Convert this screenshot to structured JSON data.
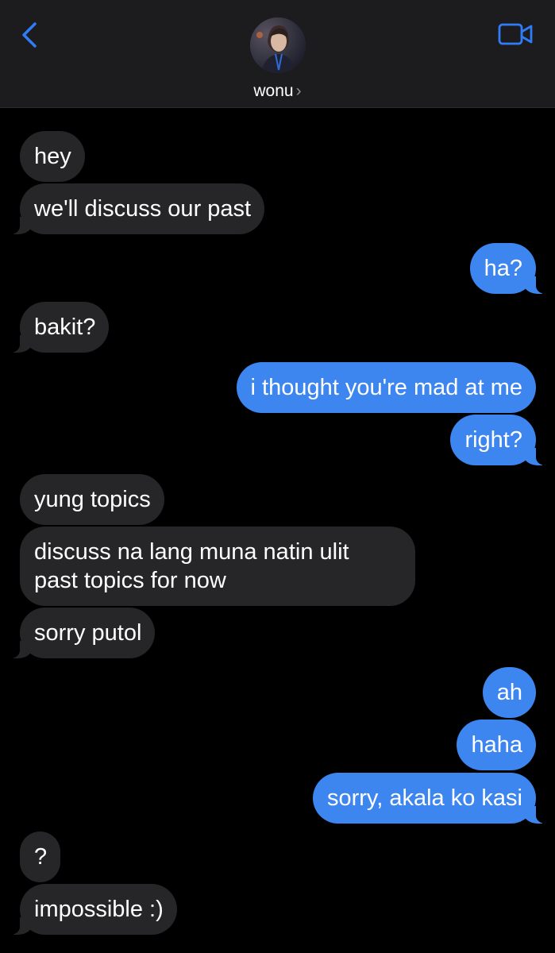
{
  "header": {
    "back_icon": "chevron-left-icon",
    "video_icon": "video-camera-icon",
    "contact_name": "wonu",
    "contact_chevron": "›",
    "accent_color": "#2f7cf6"
  },
  "messages": [
    {
      "from": "them",
      "text": "hey"
    },
    {
      "from": "them",
      "text": "we'll discuss our past"
    },
    {
      "from": "me",
      "text": "ha?"
    },
    {
      "from": "them",
      "text": "bakit?"
    },
    {
      "from": "me",
      "text": "i thought you're mad at me"
    },
    {
      "from": "me",
      "text": "right?"
    },
    {
      "from": "them",
      "text": "yung topics"
    },
    {
      "from": "them",
      "text": "discuss na lang muna natin ulit past topics for now",
      "line1": "discuss na lang muna natin ulit",
      "line2": "past topics for now"
    },
    {
      "from": "them",
      "text": "sorry putol"
    },
    {
      "from": "me",
      "text": "ah"
    },
    {
      "from": "me",
      "text": "haha"
    },
    {
      "from": "me",
      "text": "sorry, akala ko kasi"
    },
    {
      "from": "them",
      "text": "?"
    },
    {
      "from": "them",
      "text": "impossible :)"
    }
  ],
  "colors": {
    "incoming_bubble": "#262628",
    "outgoing_bubble": "#3d86f0",
    "background": "#000000",
    "header": "#1c1c1e"
  }
}
